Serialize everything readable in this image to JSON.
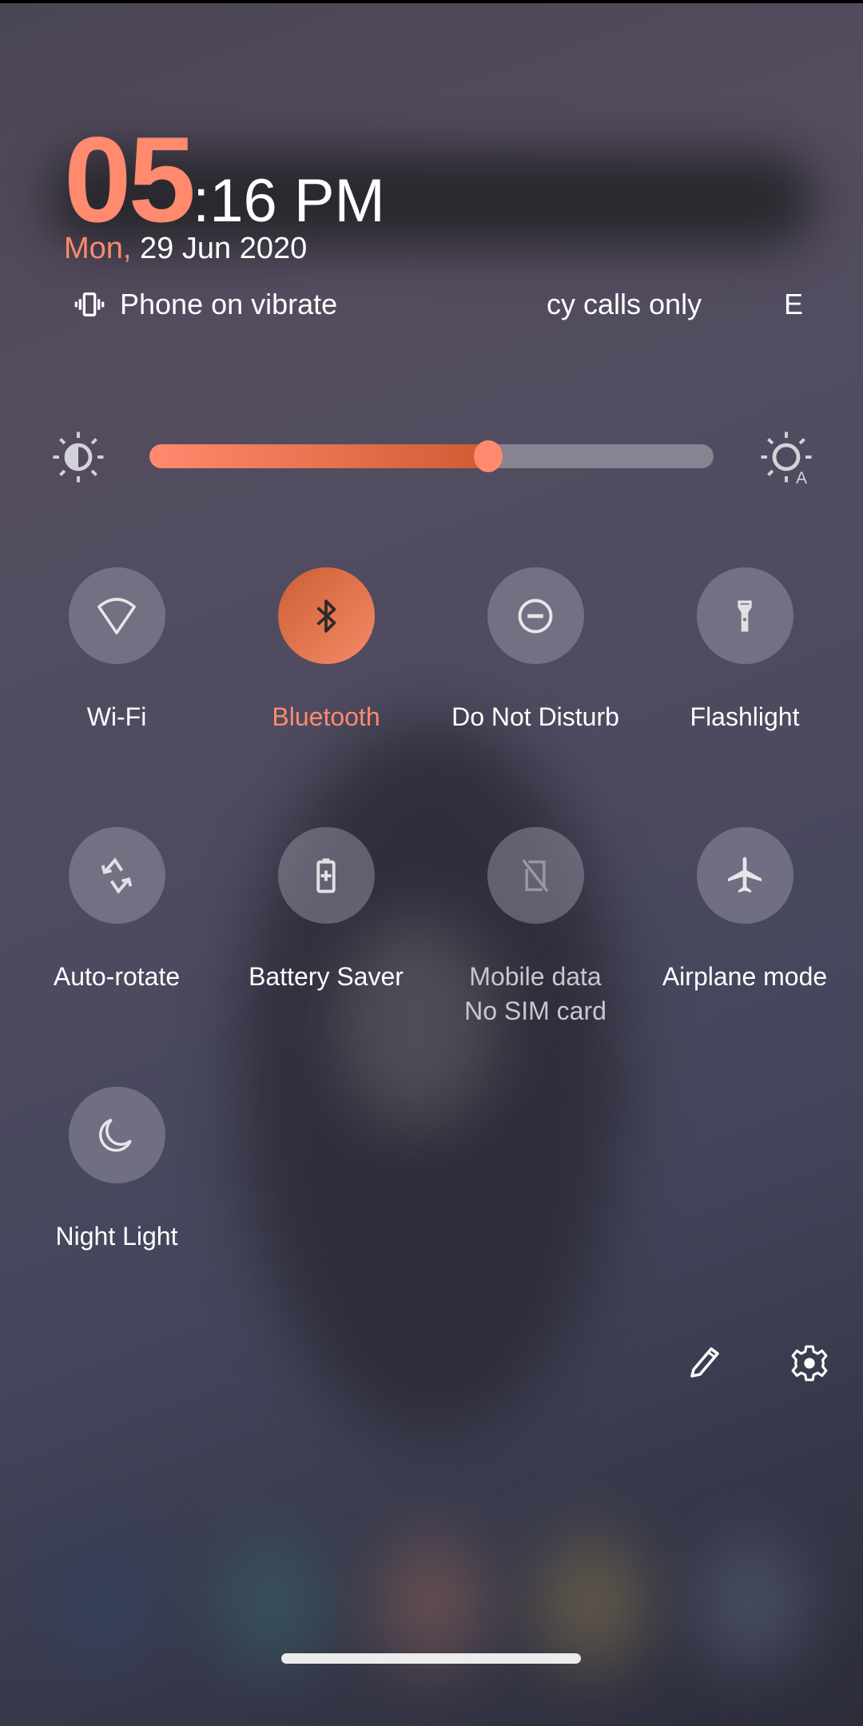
{
  "clock": {
    "hour": "05",
    "rest": ":16 PM"
  },
  "date": {
    "day": "Mon,",
    "rest": " 29 Jun 2020"
  },
  "status": {
    "vibrate": {
      "icon": "vibrate-icon",
      "text": "Phone on vibrate"
    },
    "dnd_partial": "cy calls only",
    "cut_text": "E"
  },
  "brightness": {
    "level_percent": 60,
    "low_icon": "brightness-low-icon",
    "auto_icon": "brightness-auto-icon"
  },
  "tiles": [
    {
      "label": "Wi-Fi",
      "icon": "wifi-icon",
      "state": "off"
    },
    {
      "label": "Bluetooth",
      "icon": "bluetooth-icon",
      "state": "on"
    },
    {
      "label": "Do Not Disturb",
      "icon": "do-not-disturb-icon",
      "state": "off"
    },
    {
      "label": "Flashlight",
      "icon": "flashlight-icon",
      "state": "off"
    },
    {
      "label": "Auto-rotate",
      "icon": "auto-rotate-icon",
      "state": "off"
    },
    {
      "label": "Battery Saver",
      "icon": "battery-saver-icon",
      "state": "off"
    },
    {
      "label": "Mobile data",
      "sublabel": "No SIM card",
      "icon": "no-sim-icon",
      "state": "unavailable"
    },
    {
      "label": "Airplane mode",
      "icon": "airplane-icon",
      "state": "off"
    },
    {
      "label": "Night Light",
      "icon": "moon-icon",
      "state": "off"
    }
  ],
  "actions": {
    "edit_icon": "pencil-icon",
    "settings_icon": "gear-icon"
  },
  "colors": {
    "accent": "#ff8a6e",
    "tile_off": "#8f8c9c",
    "slider_track": "#878391"
  }
}
